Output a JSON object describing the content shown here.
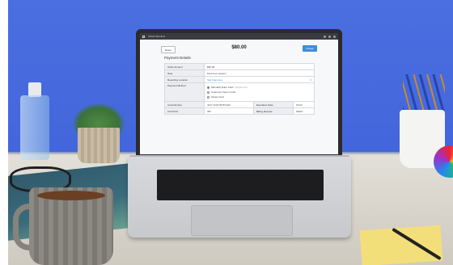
{
  "screen": {
    "window_title": "Virtual Terminal",
    "reset_label": "Reset",
    "amount": "$80.00",
    "charge_label": "Charge",
    "section_title": "Payment Details",
    "fields": {
      "order_amount": {
        "label": "Order Amount",
        "value": "$80.00"
      },
      "note": {
        "label": "Note",
        "value": "First hour session"
      },
      "reporting_location": {
        "label": "Reporting Location",
        "value": "San Francisco"
      },
      "payment_method": {
        "label": "Payment Method",
        "options": [
          {
            "label": "Manually Enter Card",
            "hint": "Mastercard",
            "selected": true
          },
          {
            "label": "Customer Card on File",
            "selected": false
          },
          {
            "label": "Swipe Card",
            "selected": false
          }
        ]
      },
      "card_number": {
        "label": "Card Number",
        "value": "4417 1234 5678 9113"
      },
      "expiration_date": {
        "label": "Expiration Date",
        "value": "07/24"
      },
      "cvv": {
        "label": "CVV/CVC",
        "value": "387"
      },
      "billing_zip": {
        "label": "Billing Zipcode",
        "value": "94010"
      }
    }
  },
  "colors": {
    "wall": "#4a6fe0",
    "accent": "#3b8ee0",
    "desk": "#dcd8d0"
  },
  "icons": [
    "chevron-down-icon",
    "radio-icon",
    "window-icon"
  ]
}
